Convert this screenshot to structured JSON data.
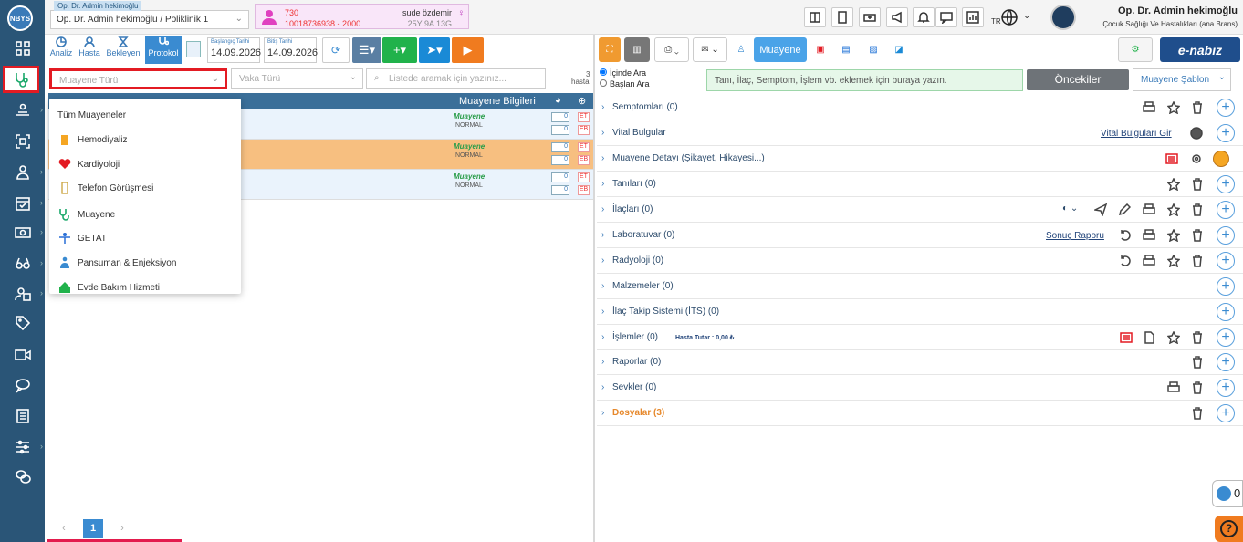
{
  "header": {
    "doctor_tag": "Op. Dr. Admin hekimoğlu",
    "doctor_select": "Op. Dr. Admin hekimoğlu / Poliklinik 1",
    "patient": {
      "protocol": "730",
      "id_line": "10018736938 - 2000",
      "name": "sude özdemir",
      "age": "25Y 9A 13G"
    },
    "lang": "TR",
    "user_name": "Op. Dr. Admin hekimoğlu",
    "user_dept": "Çocuk Sağlığı Ve Hastalıkları (ana Brans)"
  },
  "rail": {
    "logo": "NBYS"
  },
  "left": {
    "tabs": [
      "Analiz",
      "Hasta",
      "Bekleyen",
      "Protokol"
    ],
    "start_label": "Başlangıç Tarihi",
    "start_date": "14.09.2026",
    "end_label": "Bitiş Tarihi",
    "end_date": "14.09.2026",
    "filter_muayene": "Muayene Türü",
    "filter_vaka": "Vaka Türü",
    "search_placeholder": "Listede aramak için yazınız...",
    "count": "3",
    "count_unit": "hasta",
    "grid_header": "Muayene Bilgileri",
    "rows": [
      {
        "type": "Muayene",
        "status": "NORMAL"
      },
      {
        "type": "Muayene",
        "status": "NORMAL"
      },
      {
        "type": "Muayene",
        "status": "NORMAL"
      }
    ],
    "badge_zero": "0",
    "badge_et": "ET",
    "badge_eb": "EB",
    "page": "1"
  },
  "dropdown": {
    "items": [
      "Tüm Muayeneler",
      "Hemodiyaliz",
      "Kardiyoloji",
      "Telefon Görüşmesi",
      "Muayene",
      "GETAT",
      "Pansuman & Enjeksiyon",
      "Evde Bakım Hizmeti"
    ]
  },
  "right": {
    "muayene_btn": "Muayene",
    "enabiz": "e-nabız",
    "radio_in": "İçinde Ara",
    "radio_start": "Başlan Ara",
    "search_placeholder": "Tanı, İlaç, Semptom, İşlem vb. eklemek için buraya yazın.",
    "oncekiler": "Öncekiler",
    "sablon": "Muayene Şablon",
    "sections": [
      "Semptomları (0)",
      "Vital Bulgular",
      "Muayene Detayı (Şikayet, Hikayesi...)",
      "Tanıları (0)",
      "İlaçları (0)",
      "Laboratuvar (0)",
      "Radyoloji (0)",
      "Malzemeler (0)",
      "İlaç Takip Sistemi (İTS) (0)",
      "İşlemler (0)",
      "Raporlar (0)",
      "Sevkler (0)",
      "Dosyalar (3)"
    ],
    "vital_link": "Vital Bulguları Gir",
    "lab_link": "Sonuç Raporu",
    "hasta_tutar": "Hasta Tutar : 0,00 ₺",
    "counter": "0"
  },
  "colors": {
    "rail": "#2a5577",
    "primary": "#3a8bd1",
    "selected_row": "#f7bf80",
    "highlight": "#e31b23"
  }
}
